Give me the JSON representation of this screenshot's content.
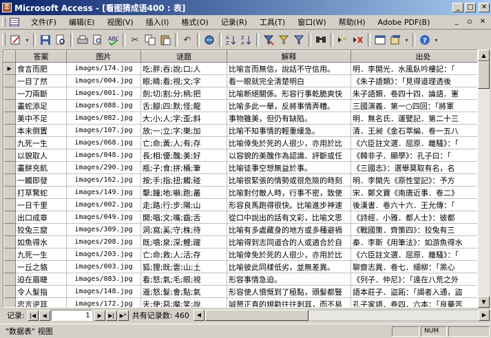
{
  "window": {
    "title": "Microsoft Access - [看图猜成语400 : 表]",
    "app_icon": "access-key-icon",
    "buttons": {
      "minimize": "_",
      "maximize": "□",
      "close": "✕"
    }
  },
  "menubar": {
    "items": [
      "文件(F)",
      "编辑(E)",
      "视图(V)",
      "插入(I)",
      "格式(O)",
      "记录(R)",
      "工具(T)",
      "窗口(W)",
      "帮助(H)",
      "Adobe PDF(B)"
    ],
    "right_buttons": [
      "_",
      "▫",
      "✕"
    ]
  },
  "toolbar": {
    "icons": [
      "design-view-icon",
      "save-icon",
      "file-search-icon",
      "print-icon",
      "print-preview-icon",
      "spelling-icon",
      "cut-icon",
      "copy-icon",
      "paste-icon",
      "undo-icon",
      "insert-hyperlink-icon",
      "sort-ascending-icon",
      "sort-descending-icon",
      "filter-by-selection-icon",
      "filter-by-form-icon",
      "apply-filter-icon",
      "find-icon",
      "new-record-icon",
      "delete-record-icon",
      "database-window-icon",
      "new-object-icon",
      "help-icon"
    ]
  },
  "grid": {
    "columns": [
      "答案",
      "图片",
      "谜题",
      "解释",
      "出处"
    ],
    "rows": [
      [
        "食言而肥",
        "images/174.jpg",
        "吃;胖;吞;說;口;人",
        "比喻言而無信，說話不守信用。",
        "明．李開光．水風臥吟樓記：「"
      ],
      [
        "一目了然",
        "images/004.jpg",
        "眼;睛;看;視;文;字",
        "看一眼就完全清楚明白",
        "《朱子語類》：「見得道理透後"
      ],
      [
        "一刀兩斷",
        "images/001.jpg",
        "劍;切;割;分;柄;把",
        "比喻断絕關係。形容行事乾脆爽快",
        "朱子語類．卷四十四．論語．憲"
      ],
      [
        "畫蛇添足",
        "images/088.jpg",
        "舌;腳;四;默;怪;龍",
        "比喻多此一舉，反將事情弄糟。",
        "三國演義．第一○四回：「將軍"
      ],
      [
        "美中不足",
        "images/082.jpg",
        "大;小;人;字;歪;斜",
        "事物雖美，但仍有缺陷。",
        "明．無名氏．運甓記．第二十三"
      ],
      [
        "本末倒置",
        "images/107.jpg",
        "放;一;立;字;樂;加",
        "比喻不知事情的輕重緩急。",
        "清．王昶《金石萃編．卷一五八"
      ],
      [
        "九死一生",
        "images/068.jpg",
        "亡;命;黃;人;有;存",
        "比喻倖免於死的人很少，亦用於比",
        "《六臣註文選．屈原．離騷》：「"
      ],
      [
        "以貌取人",
        "images/048.jpg",
        "長;相;優;醜;美;好",
        "以容貌的美醜作為認識、評斷或任",
        "《韓非子．顯學》：孔子曰：「"
      ],
      [
        "畫餅充飢",
        "images/290.jpg",
        "瓶;子;食;拼;桶;筆",
        "比喻徒事空想無益於事。",
        "《三國志》：選舉莫取有名，名"
      ],
      [
        "一觸即發",
        "images/162.jpg",
        "按;手;指;扭;觸;碰",
        "比喻很緊張的情勢或很危險的時刻",
        "明．李開先《原性堂記》：予方"
      ],
      [
        "打草驚蛇",
        "images/149.jpg",
        "擊;鐘;地;嚇;跑;叢",
        "比喻對付敵人時，行事不密，致使",
        "宋．鄭文寶《南唐近事．卷二》"
      ],
      [
        "一日千里",
        "images/002.jpg",
        "走;路;行;步;陽;山",
        "形容良馬跑得很快。比喻進步神速",
        "後漢書．卷六十六．王允傳：「"
      ],
      [
        "出口成章",
        "images/049.jpg",
        "開;唱;文;嘴;齒;舌",
        "從口中說出的話有文彩，比喻文思",
        "《詩經．小雅．都人士》：彼都"
      ],
      [
        "狡兔三窟",
        "images/309.jpg",
        "洞;窩;奚;守;株;待",
        "比喻有多處藏身的地方或多種避禍",
        "《戰國策．齊策四》：狡兔有三"
      ],
      [
        "如魚得水",
        "images/208.jpg",
        "既;噴;泉;深;鯉;躍",
        "比喻得到志同道合的人或適合於自",
        "秦．李斯《用筆法》：如游魚得水"
      ],
      [
        "九死一生",
        "images/203.jpg",
        "亡;命;救;人;活;存",
        "比喻倖免於死的人很少，亦用於比",
        "《六臣註文選．屈原．離騷》：「"
      ],
      [
        "一丘之貉",
        "images/003.jpg",
        "狐;狸;既;雲;山;土",
        "比喻彼此同樣低劣，並無差異。",
        "聊齋志異．卷七．細柳：「黑心"
      ],
      [
        "迫在眉睫",
        "images/083.jpg",
        "看;怒;氣;毛;眼;視",
        "形容事情急迫。",
        "《列子．仲尼》：「遠在八荒之外"
      ],
      [
        "令人髮指",
        "images/148.jpg",
        "邊;怒;髮;會;點;氣",
        "形容使人憤慨到了極點，頭髮都豎",
        "語本莊子．盜跖：「謁者入通，盜"
      ],
      [
        "忠言逆耳",
        "images/172.jpg",
        "天;使;惡;魔;笑;說",
        "誠懇正直的規勸往往刺耳，而不易",
        "孔子家語．卷四．六本：「良藥苦"
      ],
      [
        "八拜之交",
        "images/103.jpg",
        "鞠;躬;道;謝;禮;謙",
        "指結拜為異姓兄弟姊妹的朋友。",
        "元．王實甫《西廂記．第一本．第"
      ],
      [
        "雞犬升天",
        "images/159.jpg",
        "不;寧;飛;跳;狗;仙",
        "比喻一個人發達得勢，左右有關係",
        "漢．王充《論衡．道虛》：「淮南"
      ]
    ],
    "partial_last_row": [
      "明修棧道",
      "images/121.jpg",
      "修;路;鐵;橋;建;造",
      "表面上以某事為掩飾，實際上則進",
      "元．無名氏．暗度陳倉．第二折：「"
    ]
  },
  "navigation": {
    "label": "记录:",
    "current_record": "1",
    "total_label": "共有记录数: 460"
  },
  "statusbar": {
    "text": "\"数据表\" 视图",
    "num_indicator": "NUM"
  }
}
